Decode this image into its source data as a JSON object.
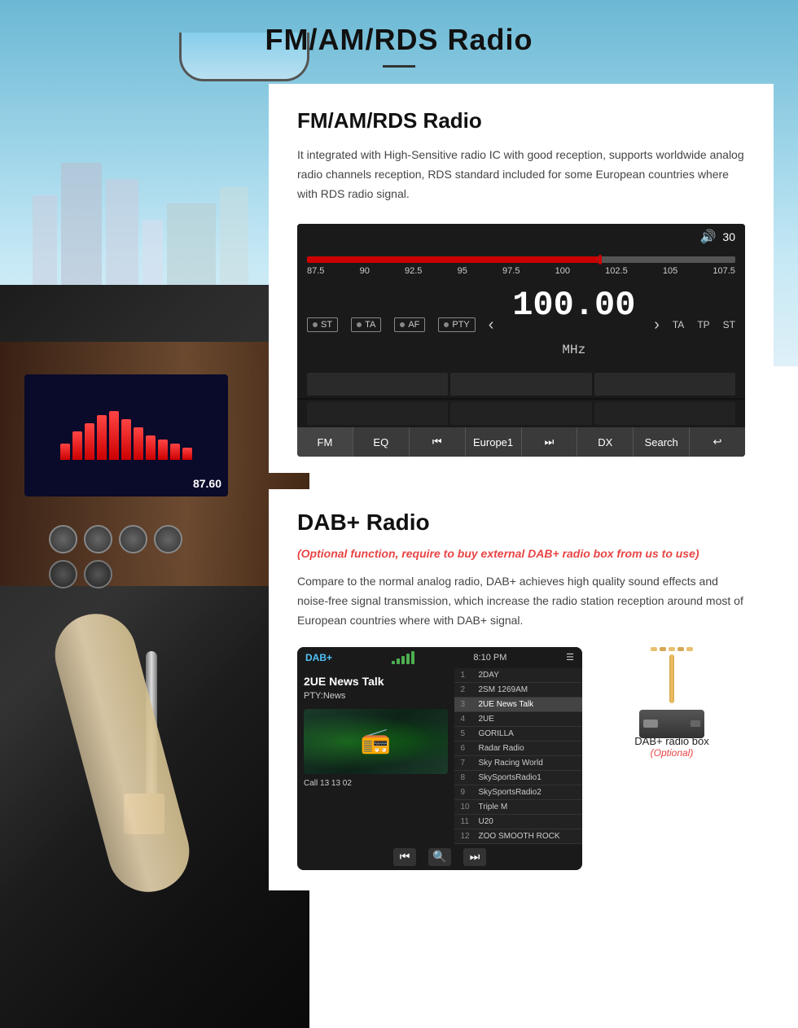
{
  "page": {
    "title": "FM/AM/RDS Radio",
    "title_divider": true
  },
  "fm_section": {
    "heading": "FM/AM/RDS Radio",
    "description": "It integrated with High-Sensitive radio IC with good reception, supports worldwide analog radio channels reception, RDS standard included for some European countries where with RDS radio signal.",
    "radio_ui": {
      "volume": "30",
      "freq_labels": [
        "87.5",
        "90",
        "92.5",
        "95",
        "97.5",
        "100",
        "102.5",
        "105",
        "107.5"
      ],
      "badges": [
        "ST",
        "TA",
        "AF",
        "PTY"
      ],
      "frequency": "100.00",
      "freq_unit": "MHz",
      "ta_labels": [
        "TA",
        "TP",
        "ST"
      ],
      "bottom_buttons": [
        "FM",
        "EQ",
        "⏮",
        "Europe1",
        "⏭",
        "DX",
        "Search",
        "↩"
      ]
    }
  },
  "dab_section": {
    "heading": "DAB+ Radio",
    "optional_text": "(Optional function, require to buy external DAB+ radio box from us to use)",
    "description": "Compare to the normal analog radio, DAB+ achieves high quality sound effects and noise-free signal transmission, which increase the radio station reception around most of European countries where with DAB+ signal.",
    "screen": {
      "header_label": "DAB+",
      "time": "8:10 PM",
      "station": "2UE News Talk",
      "pty": "PTY:News",
      "call": "Call 13 13 02",
      "channels": [
        {
          "num": "1",
          "name": "2DAY"
        },
        {
          "num": "2",
          "name": "2SM 1269AM"
        },
        {
          "num": "3",
          "name": "2UE News Talk"
        },
        {
          "num": "4",
          "name": "2UE"
        },
        {
          "num": "5",
          "name": "GORILLA"
        },
        {
          "num": "6",
          "name": "Radar Radio"
        },
        {
          "num": "7",
          "name": "Sky Racing World"
        },
        {
          "num": "8",
          "name": "SkySportsRadio1"
        },
        {
          "num": "9",
          "name": "SkySportsRadio2"
        },
        {
          "num": "10",
          "name": "Triple M"
        },
        {
          "num": "11",
          "name": "U20"
        },
        {
          "num": "12",
          "name": "ZOO SMOOTH ROCK"
        }
      ],
      "footer_buttons": [
        "⏮",
        "🔍",
        "⏭"
      ]
    },
    "dab_box": {
      "label": "DAB+ radio box",
      "sublabel": "(Optional)"
    }
  },
  "mini_bars_heights": [
    20,
    35,
    45,
    55,
    60,
    50,
    40,
    30,
    25,
    20,
    15
  ],
  "mini_freq": "87.60"
}
